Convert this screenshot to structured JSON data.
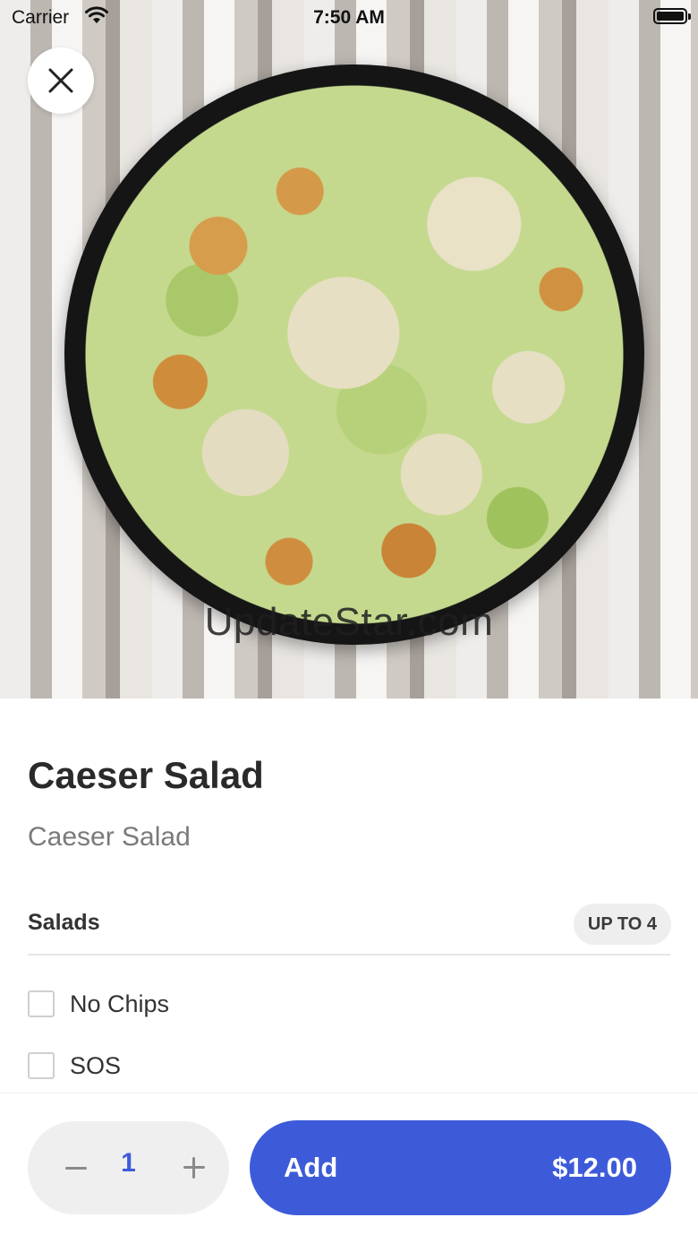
{
  "status_bar": {
    "carrier": "Carrier",
    "time": "7:50 AM"
  },
  "hero": {
    "watermark": "UpdateStar.com"
  },
  "item": {
    "title": "Caeser Salad",
    "description": "Caeser Salad"
  },
  "section": {
    "title": "Salads",
    "badge": "UP TO 4",
    "options": [
      {
        "label": "No Chips",
        "checked": false
      },
      {
        "label": "SOS",
        "checked": false
      }
    ]
  },
  "footer": {
    "quantity": "1",
    "add_label": "Add",
    "price": "$12.00"
  },
  "colors": {
    "accent": "#3d5bd9",
    "badge_bg": "#eeeeee",
    "stepper_bg": "#efefef"
  },
  "icons": {
    "close": "close-icon",
    "minus": "minus-icon",
    "plus": "plus-icon",
    "wifi": "wifi-icon",
    "battery": "battery-icon"
  }
}
